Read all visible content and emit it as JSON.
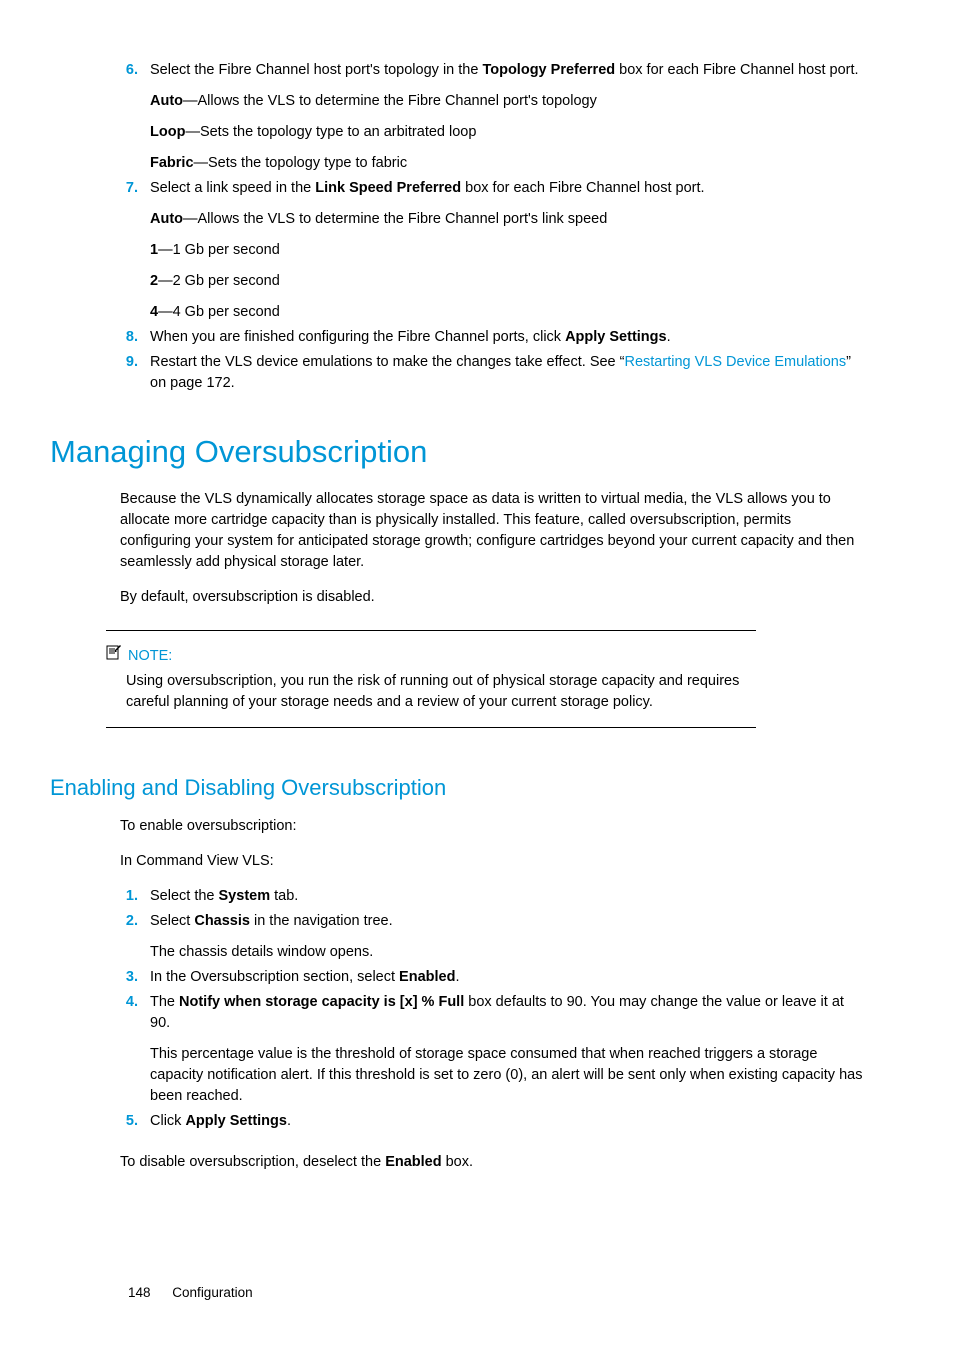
{
  "steps_a": [
    {
      "num": "6.",
      "paras": [
        [
          {
            "t": "Select the Fibre Channel host port's topology in the "
          },
          {
            "t": "Topology Preferred",
            "b": true
          },
          {
            "t": " box for each Fibre Channel host port."
          }
        ],
        [
          {
            "t": "Auto",
            "b": true
          },
          {
            "t": "—Allows the VLS to determine the Fibre Channel port's topology"
          }
        ],
        [
          {
            "t": "Loop",
            "b": true
          },
          {
            "t": "—Sets the topology type to an arbitrated loop"
          }
        ],
        [
          {
            "t": "Fabric",
            "b": true
          },
          {
            "t": "—Sets the topology type to fabric"
          }
        ]
      ]
    },
    {
      "num": "7.",
      "paras": [
        [
          {
            "t": "Select a link speed in the "
          },
          {
            "t": "Link Speed Preferred",
            "b": true
          },
          {
            "t": " box for each Fibre Channel host port."
          }
        ],
        [
          {
            "t": "Auto",
            "b": true
          },
          {
            "t": "—Allows the VLS to determine the Fibre Channel port's link speed"
          }
        ],
        [
          {
            "t": "1",
            "b": true
          },
          {
            "t": "—1 Gb per second"
          }
        ],
        [
          {
            "t": "2",
            "b": true
          },
          {
            "t": "—2 Gb per second"
          }
        ],
        [
          {
            "t": "4",
            "b": true
          },
          {
            "t": "—4 Gb per second"
          }
        ]
      ]
    },
    {
      "num": "8.",
      "paras": [
        [
          {
            "t": "When you are finished configuring the Fibre Channel ports, click "
          },
          {
            "t": "Apply Settings",
            "b": true
          },
          {
            "t": "."
          }
        ]
      ]
    },
    {
      "num": "9.",
      "paras": [
        [
          {
            "t": "Restart the VLS device emulations to make the changes take effect. See “"
          },
          {
            "t": "Restarting VLS Device Emulations",
            "link": true
          },
          {
            "t": "” on page 172."
          }
        ]
      ]
    }
  ],
  "h1": "Managing Oversubscription",
  "p1": "Because the VLS dynamically allocates storage space as data is written to virtual media, the VLS allows you to allocate more cartridge capacity than is physically installed. This feature, called oversubscription, permits configuring your system for anticipated storage growth; configure cartridges beyond your current capacity and then seamlessly add physical storage later.",
  "p2": "By default, oversubscription is disabled.",
  "note_label": "NOTE:",
  "note_body": "Using oversubscription, you run the risk of running out of physical storage capacity and requires careful planning of your storage needs and a review of your current storage policy.",
  "h2": "Enabling and Disabling Oversubscription",
  "p3": "To enable oversubscription:",
  "p4": "In Command View VLS:",
  "steps_b": [
    {
      "num": "1.",
      "paras": [
        [
          {
            "t": "Select the "
          },
          {
            "t": "System",
            "b": true
          },
          {
            "t": " tab."
          }
        ]
      ]
    },
    {
      "num": "2.",
      "paras": [
        [
          {
            "t": "Select "
          },
          {
            "t": "Chassis",
            "b": true
          },
          {
            "t": " in the navigation tree."
          }
        ],
        [
          {
            "t": "The chassis details window opens."
          }
        ]
      ]
    },
    {
      "num": "3.",
      "paras": [
        [
          {
            "t": "In the Oversubscription section, select "
          },
          {
            "t": "Enabled",
            "b": true
          },
          {
            "t": "."
          }
        ]
      ]
    },
    {
      "num": "4.",
      "paras": [
        [
          {
            "t": "The "
          },
          {
            "t": "Notify when storage capacity is [x] % Full",
            "b": true
          },
          {
            "t": " box defaults to 90. You may change the value or leave it at 90."
          }
        ],
        [
          {
            "t": "This percentage value is the threshold of storage space consumed that when reached triggers a storage capacity notification alert. If this threshold is set to zero (0), an alert will be sent only when existing capacity has been reached."
          }
        ]
      ]
    },
    {
      "num": "5.",
      "paras": [
        [
          {
            "t": "Click "
          },
          {
            "t": "Apply Settings",
            "b": true
          },
          {
            "t": "."
          }
        ]
      ]
    }
  ],
  "p5": [
    {
      "t": "To disable oversubscription, deselect the "
    },
    {
      "t": "Enabled",
      "b": true
    },
    {
      "t": " box."
    }
  ],
  "footer_page": "148",
  "footer_label": "Configuration"
}
